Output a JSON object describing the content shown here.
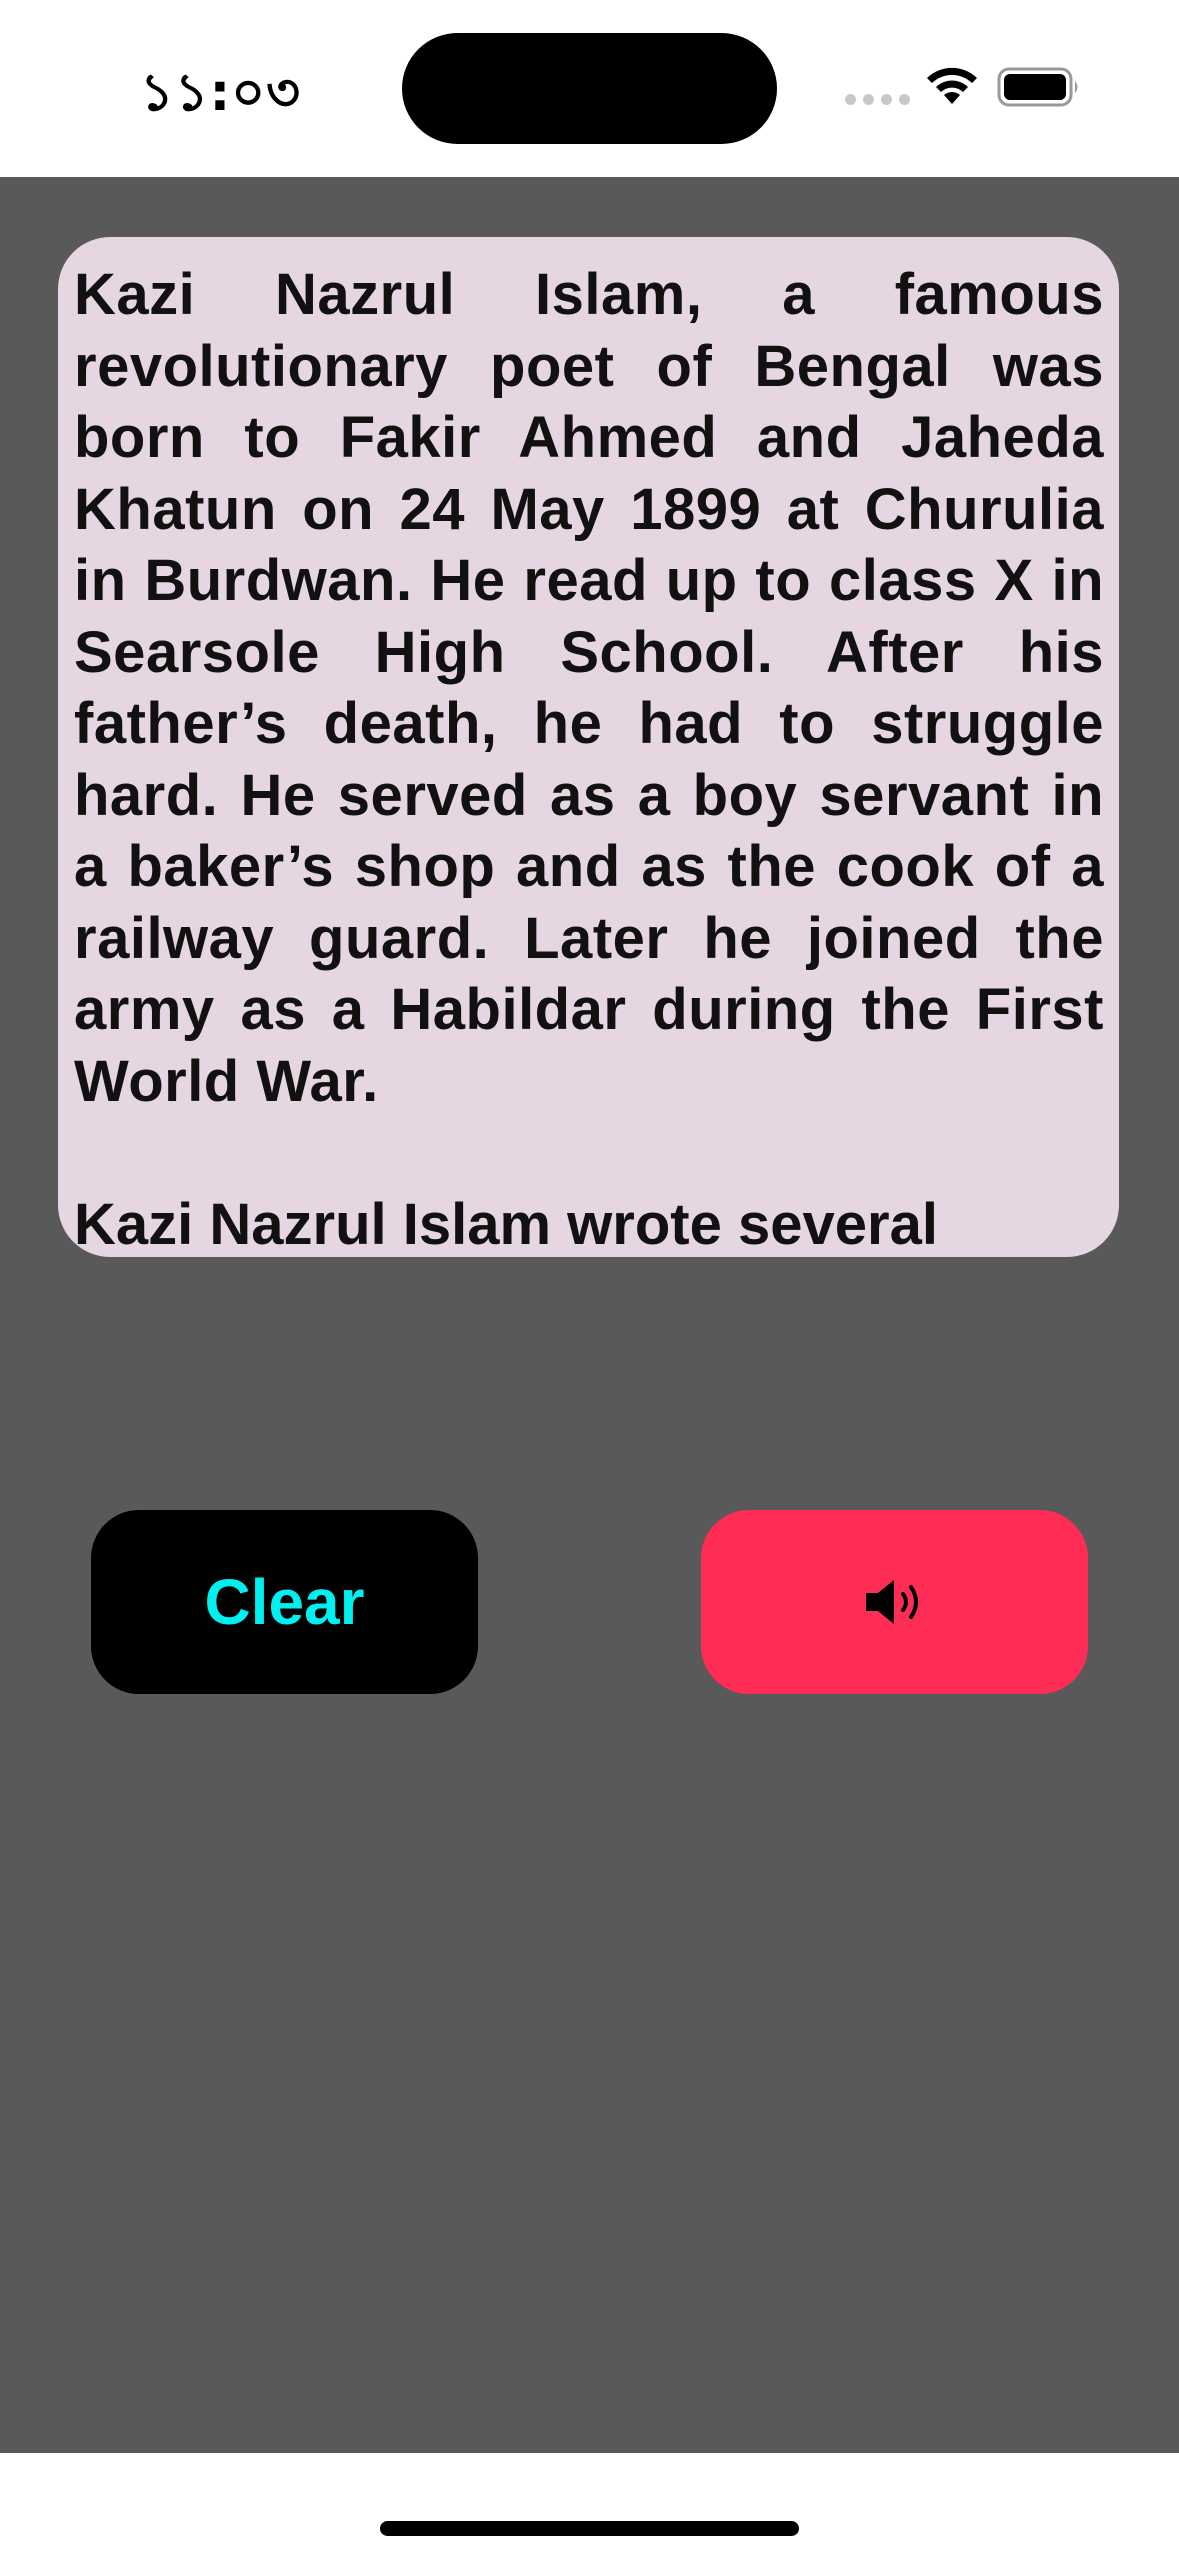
{
  "status_bar": {
    "time": "১১:০৩",
    "icons": [
      "cellular-signal-icon",
      "wifi-icon",
      "battery-icon"
    ]
  },
  "text_card": {
    "paragraphs": [
      "Kazi Nazrul Islam, a famous revolutionary poet of Bengal was born to Fakir Ahmed and Jaheda Khatun on 24 May 1899 at Churulia in Burdwan. He read up to class X in Searsole High School. After his father’s death, he had to struggle hard. He served as a boy servant in a baker’s shop and as the cook of a railway guard. Later he joined the army as a Habildar during the First World War.",
      "Kazi Nazrul Islam wrote several"
    ],
    "background": "#e5d6e1"
  },
  "buttons": {
    "clear_label": "Clear",
    "clear_color": "#00f0f0",
    "speak_icon": "speaker-icon",
    "speak_background": "#ff2d55"
  },
  "colors": {
    "app_background": "#595959"
  }
}
